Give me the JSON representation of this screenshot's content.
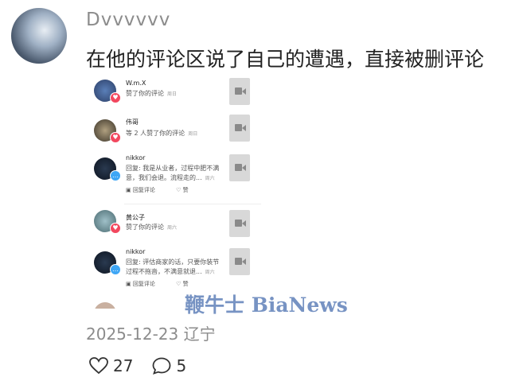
{
  "post": {
    "username": "Dvvvvvv",
    "text": "在他的评论区说了自己的遭遇，直接被删评论",
    "date": "2025-12-23",
    "location": "辽宁",
    "likes": "27",
    "comments": "5"
  },
  "embed": {
    "items": [
      {
        "name": "W.m.X",
        "sub": "赞了你的评论",
        "time": "周日",
        "type": "like"
      },
      {
        "name": "伟哥",
        "sub": "等 2 人赞了你的评论",
        "time": "周日",
        "type": "like"
      },
      {
        "name": "nikkor",
        "sub1": "回复: 我是从业者，过程中肥不满",
        "sub2": "意，我们会退。流程走的...",
        "time": "周六",
        "reply": "回复评论",
        "like": "赞",
        "type": "comment"
      },
      {
        "name": "黄公子",
        "sub": "赞了你的评论",
        "time": "周六",
        "type": "like"
      },
      {
        "name": "nikkor",
        "sub1": "回复: 评估商家的话，只要你装节",
        "sub2": "过程不拖沓，不满意就退...",
        "time": "周六",
        "reply": "回复评论",
        "like": "赞",
        "type": "comment"
      }
    ]
  },
  "watermark": "鞭牛士 BiaNews",
  "colors": {
    "like_badge": "#f2475e",
    "comment_badge": "#3ea6f5",
    "watermark": "#4a6fb0"
  }
}
